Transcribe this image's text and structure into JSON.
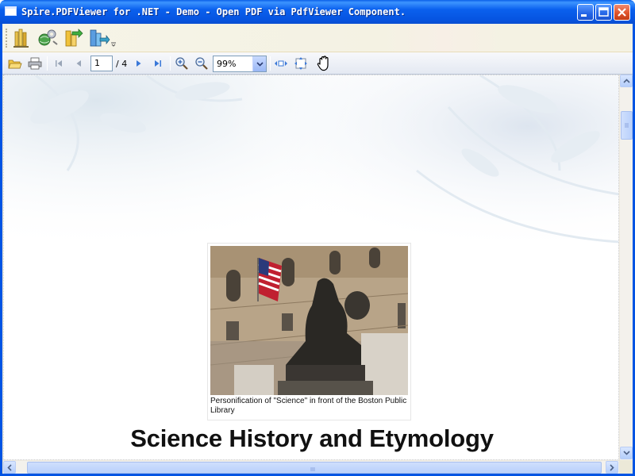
{
  "window": {
    "title": "Spire.PDFViewer for .NET - Demo - Open PDF via PdfViewer Component."
  },
  "toolbar_top": {
    "buttons": [
      {
        "name": "library-icon"
      },
      {
        "name": "gear-globe-icon"
      },
      {
        "name": "folder-open-icon"
      },
      {
        "name": "export-icon"
      }
    ]
  },
  "toolbar_nav": {
    "page_input": "1",
    "page_total": "/ 4",
    "zoom": "99%",
    "zoom_options": [
      "99%"
    ]
  },
  "document": {
    "figure_caption": "Personification of \"Science\" in front of the Boston Public Library",
    "heading": "Science History and Etymology"
  },
  "colors": {
    "titlebar": "#0a5fe8",
    "close_button": "#e0532b",
    "toolbar_nav_bg": "#e4e9f2",
    "heading_text": "#111111"
  }
}
